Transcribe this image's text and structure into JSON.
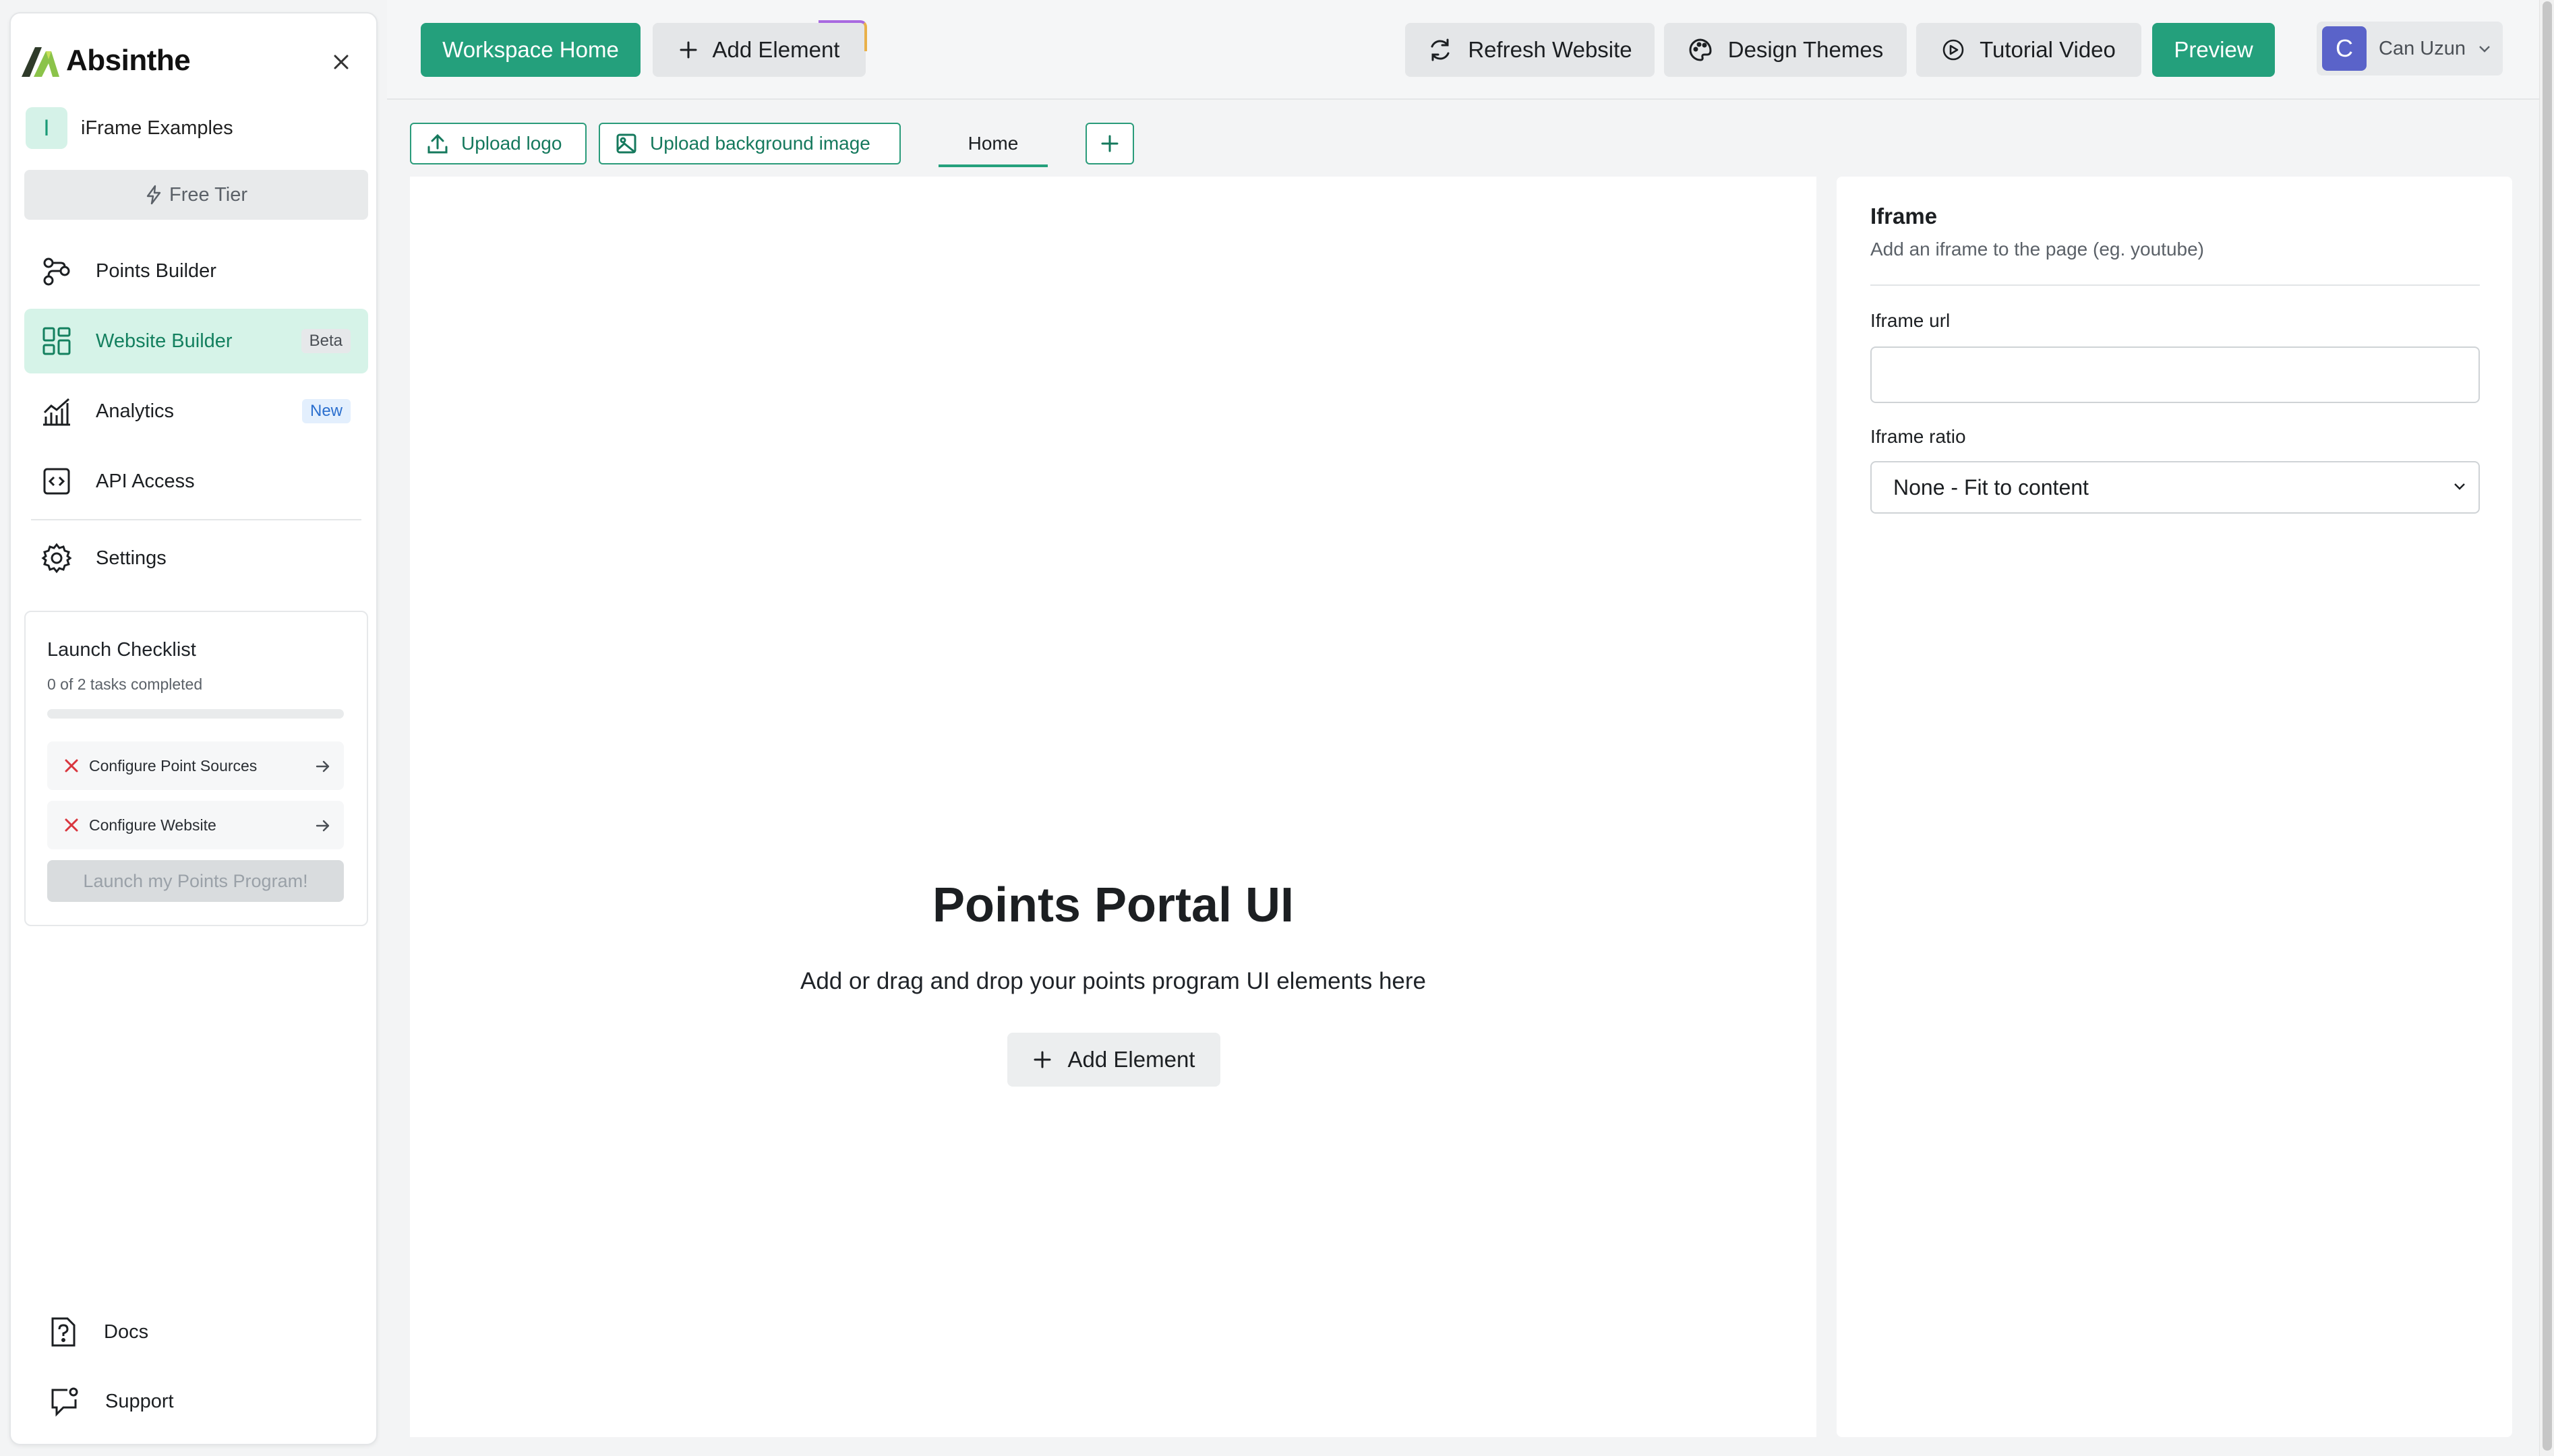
{
  "app": {
    "name": "Absinthe",
    "brand_color": "#24a07c"
  },
  "workspace": {
    "initial": "I",
    "name": "iFrame Examples"
  },
  "tier": {
    "label": "Free Tier"
  },
  "nav": [
    {
      "label": "Points Builder",
      "icon": "route-icon",
      "active": false
    },
    {
      "label": "Website Builder",
      "icon": "grid-icon",
      "active": true,
      "badge": "Beta"
    },
    {
      "label": "Analytics",
      "icon": "chart-icon",
      "active": false,
      "badge": "New"
    },
    {
      "label": "API Access",
      "icon": "code-icon",
      "active": false
    },
    {
      "label": "Settings",
      "icon": "gear-icon",
      "active": false
    }
  ],
  "checklist": {
    "title": "Launch Checklist",
    "subtitle": "0 of 2 tasks completed",
    "progress": 0,
    "tasks": [
      {
        "label": "Configure Point Sources",
        "done": false
      },
      {
        "label": "Configure Website",
        "done": false
      }
    ],
    "launch_label": "Launch my Points Program!"
  },
  "footer": {
    "docs": "Docs",
    "support": "Support"
  },
  "topbar": {
    "workspace_home": "Workspace Home",
    "add_element": "Add Element",
    "refresh": "Refresh Website",
    "themes": "Design Themes",
    "tutorial": "Tutorial Video",
    "preview": "Preview"
  },
  "user": {
    "initial": "C",
    "name": "Can Uzun"
  },
  "toolbar": {
    "upload_logo": "Upload logo",
    "upload_bg": "Upload background image",
    "tab_home": "Home"
  },
  "canvas": {
    "title": "Points Portal UI",
    "subtitle": "Add or drag and drop your points program UI elements here",
    "add_element": "Add Element"
  },
  "panel": {
    "title": "Iframe",
    "subtitle": "Add an iframe to the page (eg. youtube)",
    "url_label": "Iframe url",
    "url_value": "",
    "ratio_label": "Iframe ratio",
    "ratio_value": "None - Fit to content"
  }
}
